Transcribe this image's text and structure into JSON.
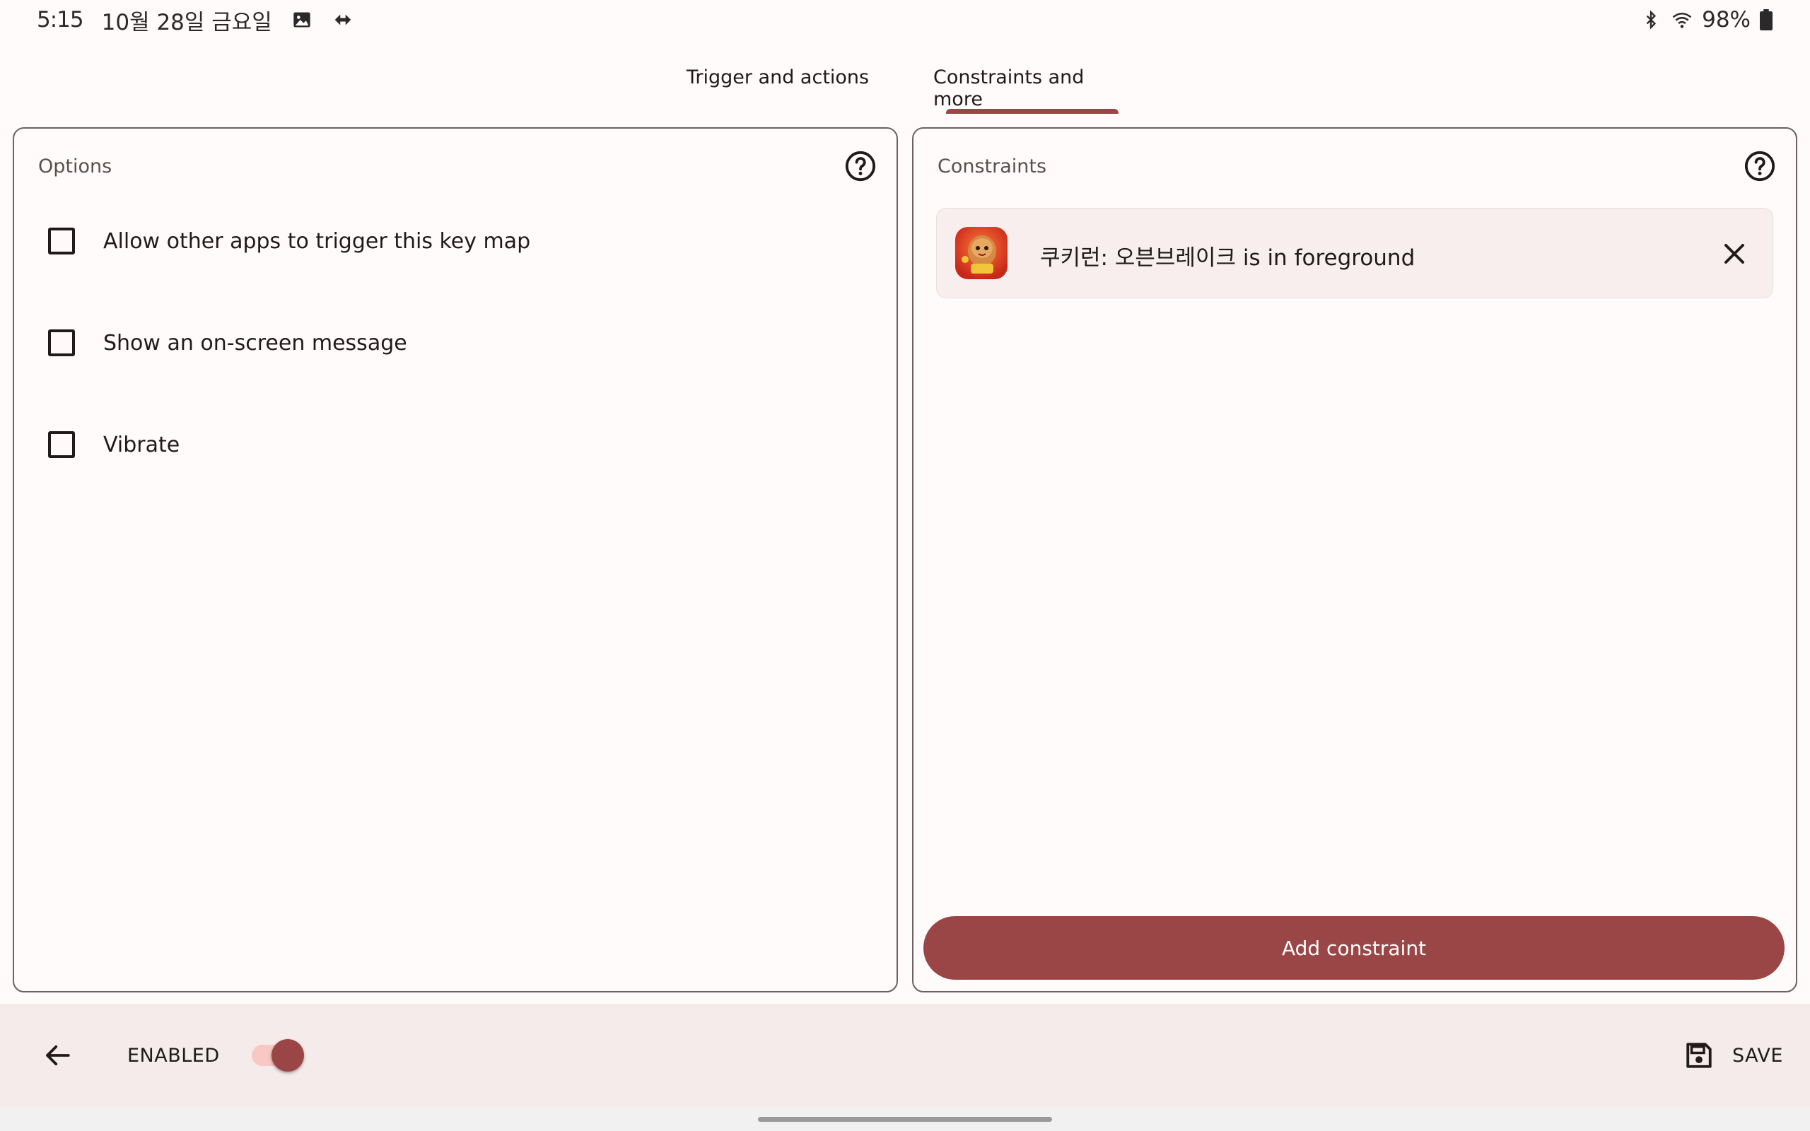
{
  "status_bar": {
    "time": "5:15",
    "date": "10월 28일 금요일",
    "battery": "98%",
    "icons": [
      "image-icon",
      "link-icon",
      "bluetooth-icon",
      "wifi-icon",
      "battery-icon"
    ]
  },
  "tabs": [
    {
      "label": "Trigger and actions",
      "selected": false
    },
    {
      "label": "Constraints and more",
      "selected": true
    }
  ],
  "options_card": {
    "title": "Options",
    "items": [
      {
        "label": "Allow other apps to trigger this key map",
        "checked": false
      },
      {
        "label": "Show an on-screen message",
        "checked": false
      },
      {
        "label": "Vibrate",
        "checked": false
      }
    ]
  },
  "constraints_card": {
    "title": "Constraints",
    "items": [
      {
        "text": "쿠키런: 오븐브레이크 is in foreground",
        "icon": "cookie-run-app-icon"
      }
    ],
    "add_button_label": "Add constraint"
  },
  "bottom_bar": {
    "enabled_label": "ENABLED",
    "enabled": true,
    "save_label": "SAVE"
  },
  "colors": {
    "accent": "#9a4646",
    "background": "#fffbfa",
    "bottom_bar": "#f5ebea"
  }
}
